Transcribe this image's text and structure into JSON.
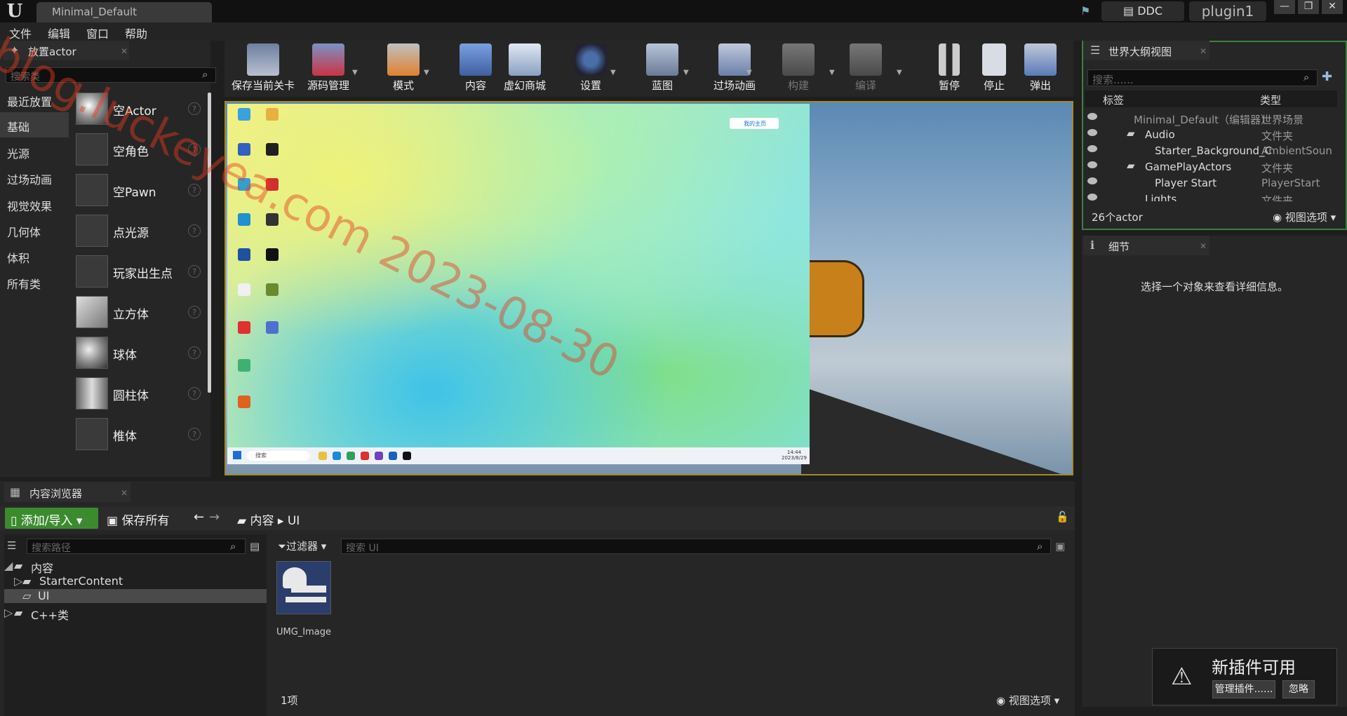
{
  "title_bar": {
    "doc_tab": "Minimal_Default",
    "ddc_label": "DDC",
    "plugin_label": "plugin1",
    "minimize": "—",
    "restore": "❐",
    "close": "✕"
  },
  "menu": [
    "文件",
    "编辑",
    "窗口",
    "帮助"
  ],
  "place_actor": {
    "tab_label": "放置actor",
    "search_placeholder": "搜索类",
    "categories": [
      "最近放置",
      "基础",
      "光源",
      "过场动画",
      "视觉效果",
      "几何体",
      "体积",
      "所有类"
    ],
    "active_category": "基础",
    "items": [
      "空Actor",
      "空角色",
      "空Pawn",
      "点光源",
      "玩家出生点",
      "立方体",
      "球体",
      "圆柱体",
      "椎体"
    ]
  },
  "toolbar": {
    "buttons": [
      {
        "label": "保存当前关卡",
        "icon": "save-icon",
        "enabled": true
      },
      {
        "label": "源码管理",
        "icon": "source-control-icon",
        "enabled": true
      },
      {
        "label": "模式",
        "icon": "modes-icon",
        "enabled": true
      },
      {
        "label": "内容",
        "icon": "content-icon",
        "enabled": true
      },
      {
        "label": "虚幻商城",
        "icon": "marketplace-icon",
        "enabled": true
      },
      {
        "label": "设置",
        "icon": "settings-icon",
        "enabled": true
      },
      {
        "label": "蓝图",
        "icon": "blueprint-icon",
        "enabled": true
      },
      {
        "label": "过场动画",
        "icon": "cinematics-icon",
        "enabled": true
      },
      {
        "label": "构建",
        "icon": "build-icon",
        "enabled": false
      },
      {
        "label": "编译",
        "icon": "compile-icon",
        "enabled": false
      },
      {
        "label": "暂停",
        "icon": "pause-icon",
        "enabled": true
      },
      {
        "label": "停止",
        "icon": "stop-icon",
        "enabled": true
      },
      {
        "label": "弹出",
        "icon": "eject-icon",
        "enabled": true
      }
    ]
  },
  "viewport": {
    "desktop_badge": "我的主页",
    "taskbar_search": "搜索",
    "clock_time": "14:44",
    "clock_date": "2023/8/29"
  },
  "outliner": {
    "tab_label": "世界大纲视图",
    "search_placeholder": "搜索......",
    "col_label": "标签",
    "col_type": "类型",
    "rows": [
      {
        "label": "Minimal_Default（编辑器）",
        "type": "世界场景"
      },
      {
        "label": "Audio",
        "type": "文件夹"
      },
      {
        "label": "Starter_Background_C",
        "type": "AmbientSoun"
      },
      {
        "label": "GamePlayActors",
        "type": "文件夹"
      },
      {
        "label": "Player Start",
        "type": "PlayerStart"
      },
      {
        "label": "Lights",
        "type": "文件夹"
      }
    ],
    "actor_count": "26个actor",
    "view_options": "视图选项"
  },
  "details": {
    "tab_label": "细节",
    "empty_message": "选择一个对象来查看详细信息。"
  },
  "content_browser": {
    "tab_label": "内容浏览器",
    "add_import": "添加/导入",
    "save_all": "保存所有",
    "breadcrumb": [
      "内容",
      "UI"
    ],
    "path_search_placeholder": "搜索路径",
    "tree": [
      "内容",
      "StarterContent",
      "UI",
      "C++类"
    ],
    "filter_label": "过滤器",
    "asset_search_placeholder": "搜索 UI",
    "assets": [
      "UMG_Image"
    ],
    "item_count": "1项",
    "view_options": "视图选项"
  },
  "notification": {
    "title": "新插件可用",
    "manage_button": "管理插件......",
    "ignore_button": "忽略"
  },
  "watermark": "blog.luckeyea.com 2023-08-30",
  "colors": {
    "accent_green": "#3b8b2e",
    "viewport_border": "#a08a2c",
    "outliner_border": "#3f7f3f"
  }
}
